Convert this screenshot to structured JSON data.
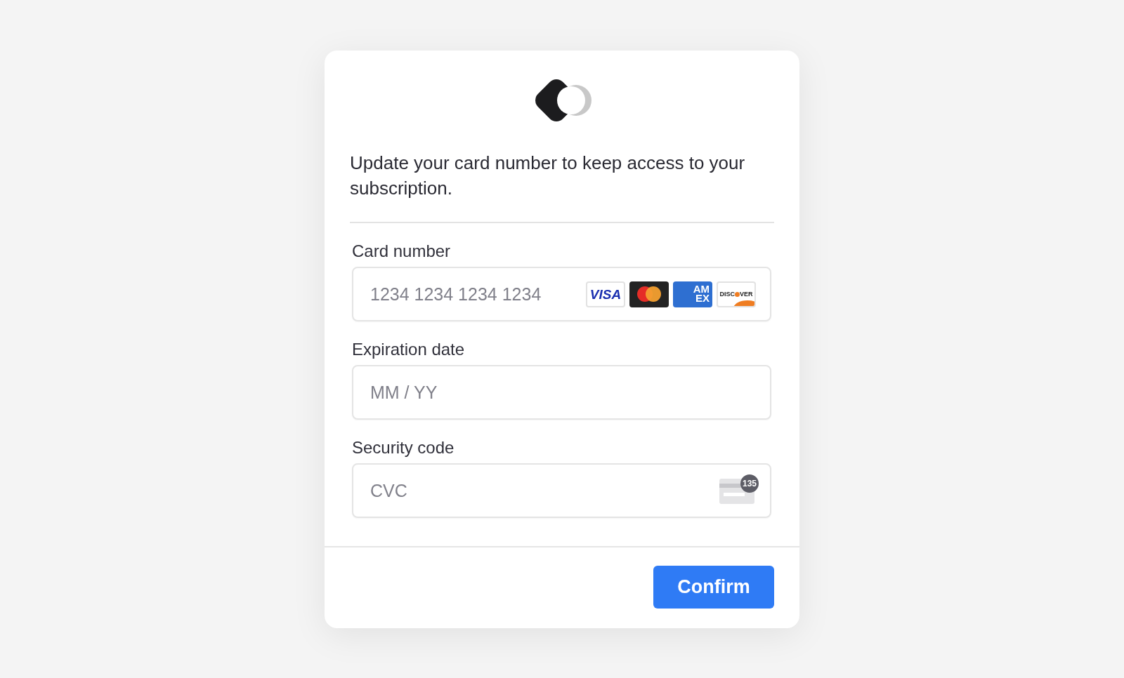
{
  "message": "Update your card number to keep access to your subscription.",
  "fields": [
    {
      "kind": "card",
      "label": "Card number",
      "placeholder": "1234 1234 1234 1234",
      "brands": [
        {
          "kind": "visa",
          "lines": [
            "VISA"
          ]
        },
        {
          "kind": "mastercard"
        },
        {
          "kind": "amex",
          "lines": [
            "AM",
            "EX"
          ]
        },
        {
          "kind": "discover",
          "lines": [
            "DISC",
            "VER"
          ]
        }
      ]
    },
    {
      "kind": "plain",
      "label": "Expiration date",
      "placeholder": "MM / YY"
    },
    {
      "kind": "cvc",
      "label": "Security code",
      "placeholder": "CVC",
      "hint": "135"
    }
  ],
  "button": "Confirm"
}
